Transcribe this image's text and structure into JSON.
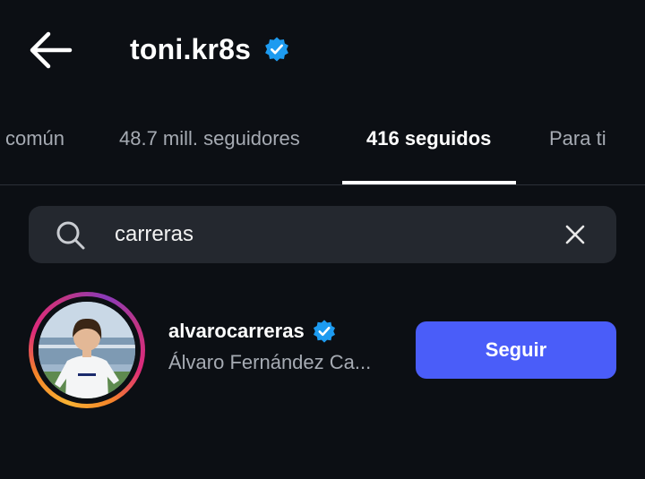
{
  "header": {
    "back_icon": "arrow-left-icon",
    "title": "toni.kr8s",
    "verified_icon": "verified-badge-icon",
    "verified_color": "#1d9bf0"
  },
  "tabs": [
    {
      "label": "común",
      "active": false
    },
    {
      "label": "48.7 mill. seguidores",
      "active": false
    },
    {
      "label": "416 seguidos",
      "active": true
    },
    {
      "label": "Para ti",
      "active": false
    }
  ],
  "search": {
    "icon": "search-icon",
    "value": "carreras",
    "clear_icon": "close-icon"
  },
  "results": [
    {
      "username": "alvarocarreras",
      "verified": true,
      "full_name": "Álvaro Fernández Ca...",
      "action_label": "Seguir",
      "avatar_has_story_ring": true
    }
  ],
  "colors": {
    "background": "#0c0f14",
    "search_bg": "#24282f",
    "accent_button": "#4a5df9",
    "muted_text": "#a6abb3"
  }
}
